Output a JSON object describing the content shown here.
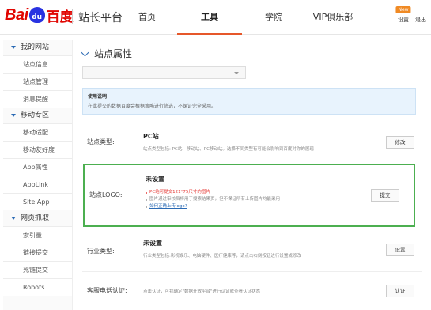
{
  "header": {
    "logo_bai": "Bai",
    "logo_du": "du",
    "logo_cn": "百度",
    "site_title": "站长平台",
    "nav": [
      {
        "label": "首页"
      },
      {
        "label": "工具"
      },
      {
        "label": "学院"
      },
      {
        "label": "VIP俱乐部"
      }
    ],
    "active_nav": "工具",
    "accent_color": "#e6572a",
    "new_badge": "New",
    "settings_label": "设置",
    "logout_label": "退出"
  },
  "sidebar": {
    "groups": [
      {
        "label": "我的网站",
        "items": [
          "站点信息",
          "站点管理",
          "消息提醒"
        ]
      },
      {
        "label": "移动专区",
        "items": [
          "移动适配",
          "移动友好度",
          "App属性",
          "AppLink",
          "Site App"
        ]
      },
      {
        "label": "网页抓取",
        "items": [
          "索引量",
          "链接提交",
          "死链提交",
          "Robots"
        ]
      }
    ]
  },
  "main": {
    "title": "站点属性",
    "notice": {
      "title": "使用说明",
      "text": "在此提交的数据百度会根据策略进行筛选，不保证完全采用。"
    },
    "rows": {
      "site_type": {
        "label": "站点类型:",
        "value": "PC站",
        "desc": "站点类型包括: PC站、移动站、PC移动站。选择不同类型有可能会影响到百度对你的展现",
        "button": "修改"
      },
      "site_logo": {
        "label": "站点LOGO:",
        "value": "未设置",
        "bullets": [
          "PC站可提交121*75尺寸的图片",
          "图片通过审核后将用于搜索结果页，但不保证所有上传图片均能采用",
          "如何正确上传logo?"
        ],
        "button": "提交",
        "highlight_color": "#4caf50"
      },
      "industry": {
        "label": "行业类型:",
        "value": "未设置",
        "desc": "行业类型包括:影视娱乐、电脑硬件、医疗健康等，请点击右侧按钮进行设置或修改",
        "button": "设置"
      },
      "phone": {
        "label": "客服电话认证:",
        "desc": "点击认证，可我确定\"数据开放平台\"进行认证或查看认证状态",
        "button": "认证"
      }
    }
  }
}
